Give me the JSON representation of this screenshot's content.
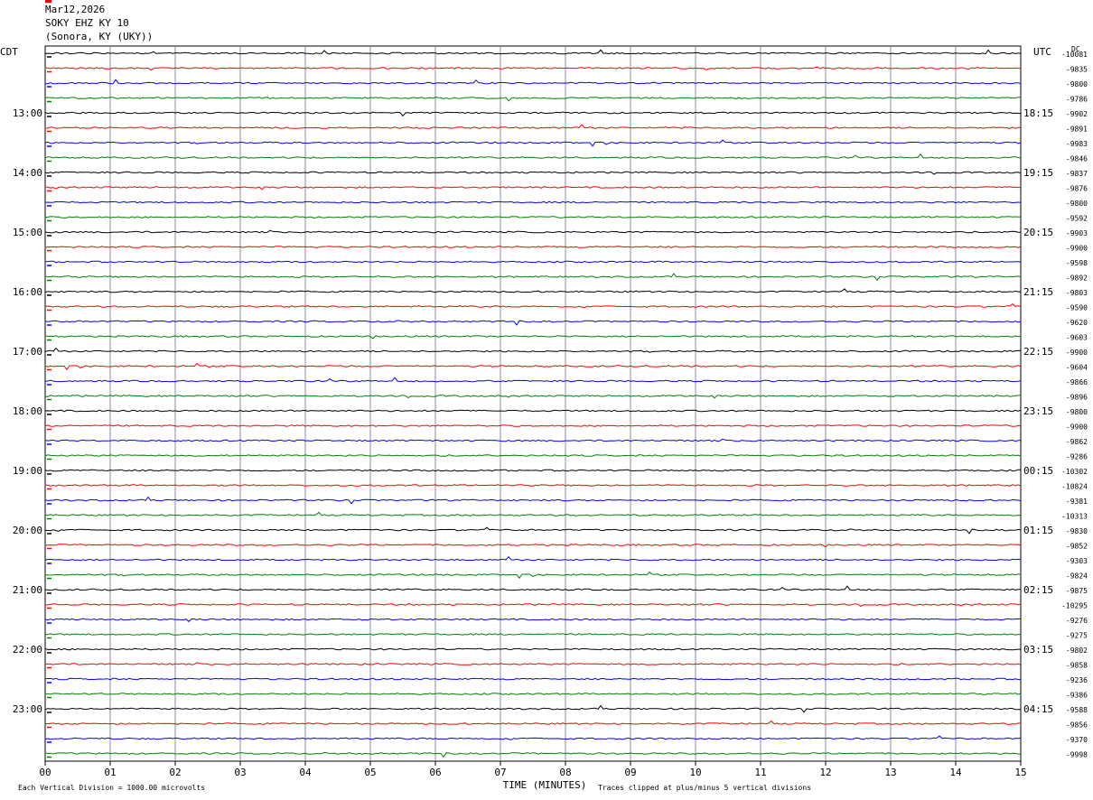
{
  "header": {
    "date": "Mar12,2026",
    "station": "SOKY EHZ KY 10",
    "location": "(Sonora, KY (UKY))"
  },
  "chart_data": {
    "type": "line",
    "left_tz": "CDT",
    "right_tz": "UTC",
    "dc_label": "DC",
    "xlabel": "TIME (MINUTES)",
    "xlim": [
      0,
      15
    ],
    "x_ticks": [
      "00",
      "01",
      "02",
      "03",
      "04",
      "05",
      "06",
      "07",
      "08",
      "09",
      "10",
      "11",
      "12",
      "13",
      "14",
      "15"
    ],
    "left_hour_labels": [
      "13:00",
      "14:00",
      "15:00",
      "16:00",
      "17:00",
      "18:00",
      "19:00",
      "20:00",
      "21:00",
      "22:00",
      "23:00"
    ],
    "right_hour_labels": [
      "18:15",
      "19:15",
      "20:15",
      "21:15",
      "22:15",
      "23:15",
      "00:15",
      "01:15",
      "02:15",
      "03:15",
      "04:15"
    ],
    "first_labeled_trace": 4,
    "traces_per_hour": 4,
    "trace_colors": [
      "#000000",
      "#ff0000",
      "#0000ff",
      "#008000"
    ],
    "dc_offsets": [
      "-10081",
      "-9835",
      "-9800",
      "-9786",
      "-9902",
      "-9891",
      "-9983",
      "-9846",
      "-9837",
      "-9876",
      "-9800",
      "-9592",
      "-9903",
      "-9900",
      "-9598",
      "-9892",
      "-9803",
      "-9590",
      "-9620",
      "-9603",
      "-9900",
      "-9604",
      "-9866",
      "-9896",
      "-9800",
      "-9900",
      "-9862",
      "-9286",
      "-10302",
      "-10824",
      "-9381",
      "-10313",
      "-9830",
      "-9852",
      "-9303",
      "-9824",
      "-9875",
      "-10295",
      "-9276",
      "-9275",
      "-9802",
      "-9858",
      "-9236",
      "-9386",
      "-9588",
      "-9856",
      "-9370",
      "-9998"
    ],
    "grid": true,
    "footer_left": "Each Vertical Division = 1000.00 microvolts",
    "footer_right": "Traces clipped at plus/minus 5 vertical divisions"
  }
}
